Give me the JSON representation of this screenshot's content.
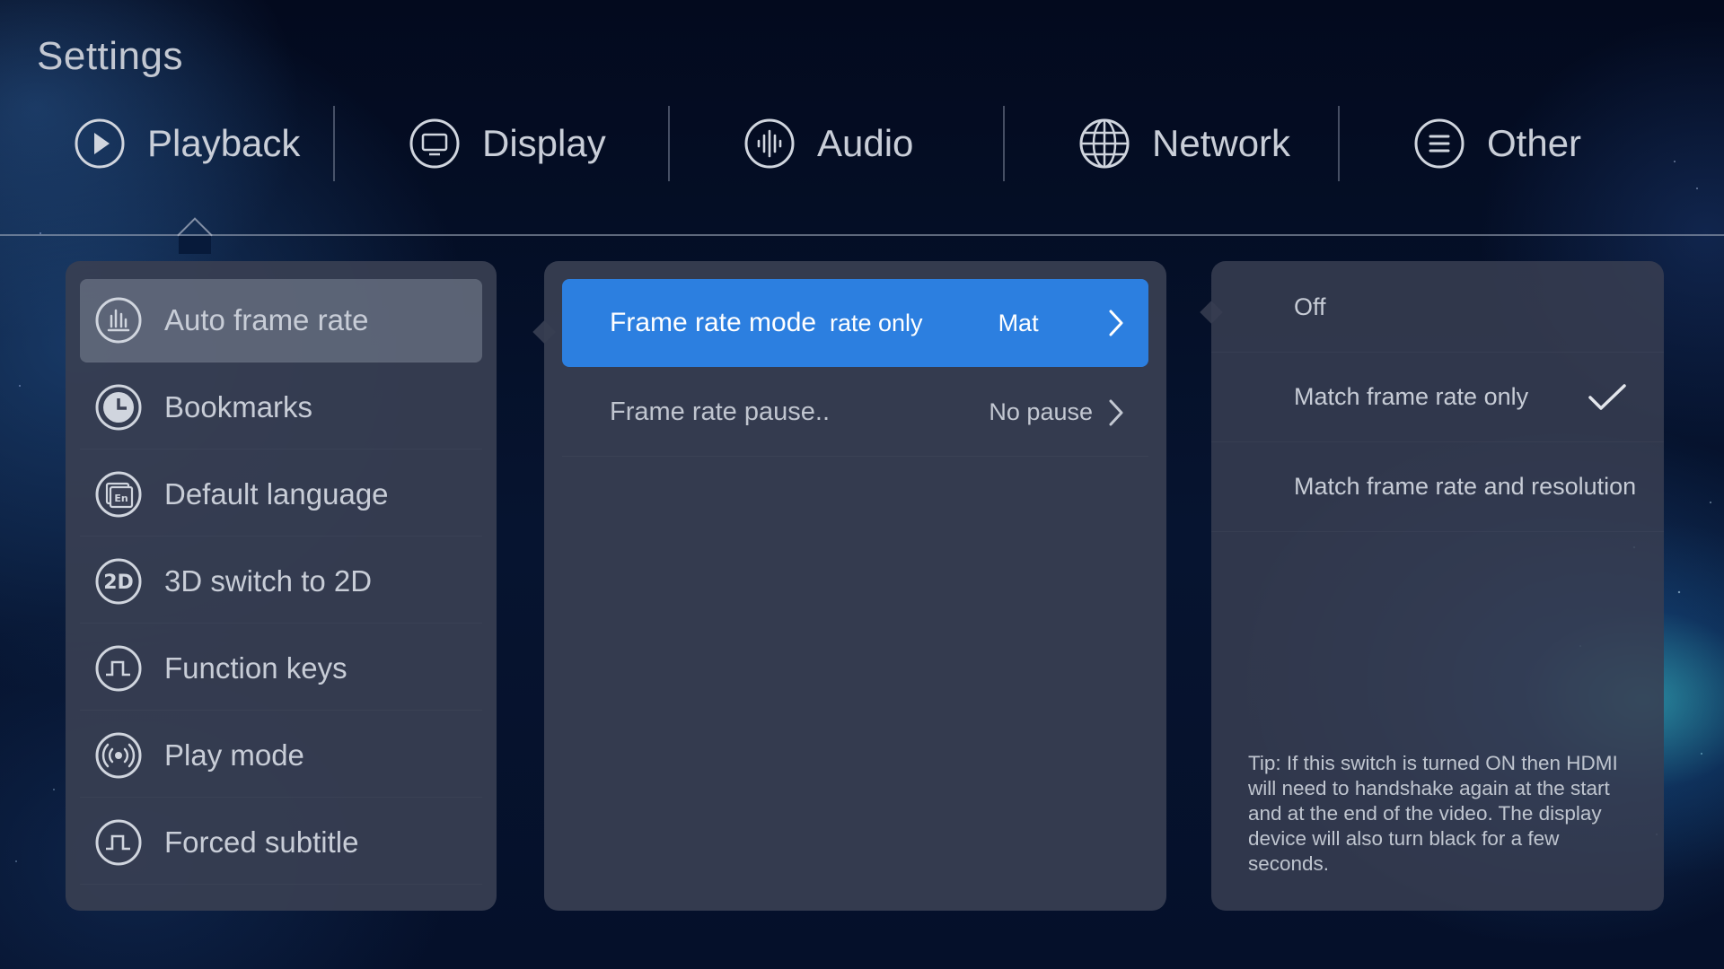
{
  "app_title": "Settings",
  "tabs": [
    {
      "label": "Playback",
      "icon": "play-icon",
      "selected": true
    },
    {
      "label": "Display",
      "icon": "monitor-icon",
      "selected": false
    },
    {
      "label": "Audio",
      "icon": "audio-wave-icon",
      "selected": false
    },
    {
      "label": "Network",
      "icon": "globe-icon",
      "selected": false
    },
    {
      "label": "Other",
      "icon": "menu-icon",
      "selected": false
    }
  ],
  "sidebar": {
    "items": [
      {
        "label": "Auto frame rate",
        "icon": "bar-chart-icon",
        "selected": true
      },
      {
        "label": "Bookmarks",
        "icon": "clock-icon",
        "selected": false
      },
      {
        "label": "Default language",
        "icon": "language-en-icon",
        "selected": false
      },
      {
        "label": "3D switch to 2D",
        "icon": "2d-icon",
        "selected": false
      },
      {
        "label": "Function keys",
        "icon": "pulse-icon",
        "selected": false
      },
      {
        "label": "Play mode",
        "icon": "broadcast-icon",
        "selected": false
      },
      {
        "label": "Forced subtitle",
        "icon": "pulse-icon",
        "selected": false
      }
    ]
  },
  "options": [
    {
      "label": "Frame rate mode",
      "value_scroll_a": "rate only",
      "value_scroll_b": "Mat",
      "selected": true
    },
    {
      "label": "Frame rate pause..",
      "value": "No pause",
      "selected": false
    }
  ],
  "choices": [
    {
      "label": "Off",
      "checked": false
    },
    {
      "label": "Match frame rate only",
      "checked": true
    },
    {
      "label": "Match frame rate and resolution",
      "checked": false
    }
  ],
  "tip": "Tip: If this switch is turned ON then HDMI will need to handshake again at the start and at the end of the video. The display device will also turn black for a few seconds.",
  "colors": {
    "accent": "#2c7fe0",
    "panel": "#383e52",
    "background": "#061430"
  }
}
